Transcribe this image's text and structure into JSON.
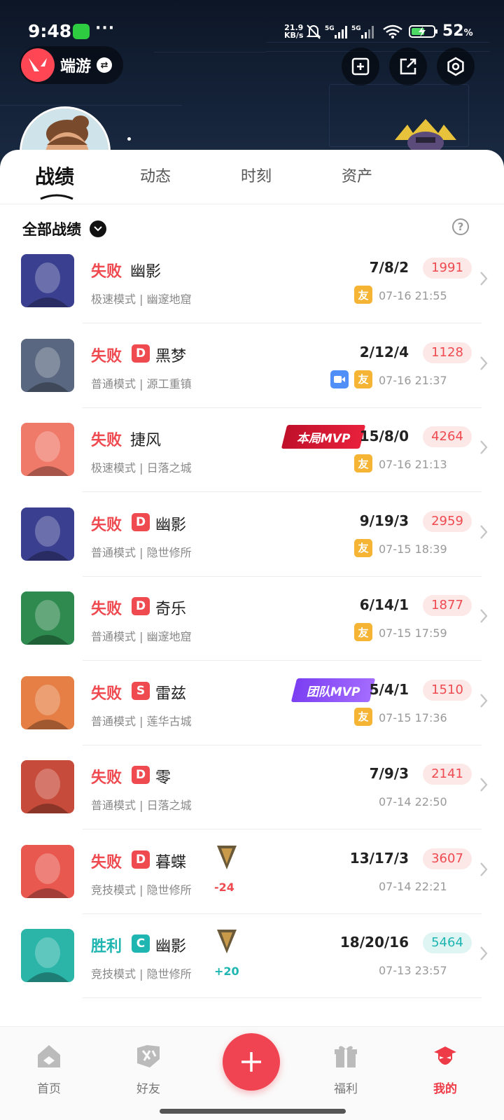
{
  "status_bar": {
    "time": "9:48",
    "speed_value": "21.9",
    "speed_unit": "KB/s",
    "network": "5G",
    "battery": "52",
    "battery_unit": "%"
  },
  "header": {
    "app_switch_label": "端游"
  },
  "tabs": [
    {
      "label": "战绩",
      "active": true
    },
    {
      "label": "动态",
      "active": false
    },
    {
      "label": "时刻",
      "active": false
    },
    {
      "label": "资产",
      "active": false
    }
  ],
  "filter": {
    "label": "全部战绩",
    "help": "?"
  },
  "matches": [
    {
      "result": "失败",
      "outcome": "lose",
      "grade": "",
      "agent": "幽影",
      "mode": "极速模式 | 幽邃地窟",
      "kda": "7/8/2",
      "score": "1991",
      "time": "07-16 21:55",
      "friend": "友",
      "video": false,
      "mvp": "",
      "rr": ""
    },
    {
      "result": "失败",
      "outcome": "lose",
      "grade": "D",
      "agent": "黑梦",
      "mode": "普通模式 | 源工重镇",
      "kda": "2/12/4",
      "score": "1128",
      "time": "07-16 21:37",
      "friend": "友",
      "video": true,
      "mvp": "",
      "rr": ""
    },
    {
      "result": "失败",
      "outcome": "lose",
      "grade": "",
      "agent": "捷风",
      "mode": "极速模式 | 日落之城",
      "kda": "15/8/0",
      "score": "4264",
      "time": "07-16 21:13",
      "friend": "友",
      "video": false,
      "mvp": "本局MVP",
      "rr": ""
    },
    {
      "result": "失败",
      "outcome": "lose",
      "grade": "D",
      "agent": "幽影",
      "mode": "普通模式 | 隐世修所",
      "kda": "9/19/3",
      "score": "2959",
      "time": "07-15 18:39",
      "friend": "友",
      "video": false,
      "mvp": "",
      "rr": ""
    },
    {
      "result": "失败",
      "outcome": "lose",
      "grade": "D",
      "agent": "奇乐",
      "mode": "普通模式 | 幽邃地窟",
      "kda": "6/14/1",
      "score": "1877",
      "time": "07-15 17:59",
      "friend": "友",
      "video": false,
      "mvp": "",
      "rr": ""
    },
    {
      "result": "失败",
      "outcome": "lose",
      "grade": "S",
      "agent": "雷兹",
      "mode": "普通模式 | 莲华古城",
      "kda": "5/4/1",
      "score": "1510",
      "time": "07-15 17:36",
      "friend": "友",
      "video": false,
      "mvp": "团队MVP",
      "rr": ""
    },
    {
      "result": "失败",
      "outcome": "lose",
      "grade": "D",
      "agent": "零",
      "mode": "普通模式 | 日落之城",
      "kda": "7/9/3",
      "score": "2141",
      "time": "07-14 22:50",
      "friend": "",
      "video": false,
      "mvp": "",
      "rr": ""
    },
    {
      "result": "失败",
      "outcome": "lose",
      "grade": "D",
      "agent": "暮蝶",
      "mode": "竞技模式 | 隐世修所",
      "kda": "13/17/3",
      "score": "3607",
      "time": "07-14 22:21",
      "friend": "",
      "video": false,
      "mvp": "",
      "rr": "-24"
    },
    {
      "result": "胜利",
      "outcome": "win",
      "grade": "C",
      "agent": "幽影",
      "mode": "竞技模式 | 隐世修所",
      "kda": "18/20/16",
      "score": "5464",
      "time": "07-13 23:57",
      "friend": "",
      "video": false,
      "mvp": "",
      "rr": "+20"
    }
  ],
  "bottom_nav": [
    {
      "label": "首页",
      "icon": "home-icon",
      "active": false
    },
    {
      "label": "好友",
      "icon": "friends-icon",
      "active": false
    },
    {
      "label": "福利",
      "icon": "gift-icon",
      "active": false
    },
    {
      "label": "我的",
      "icon": "profile-icon",
      "active": true
    }
  ],
  "colors": {
    "accent": "#f04452",
    "lose": "#ee4a50",
    "win": "#1fb5b0",
    "friend_badge": "#f5b433",
    "video_badge": "#4f8ff7",
    "grade_lose": "#ee4a50",
    "grade_win": "#1fb5b0"
  }
}
